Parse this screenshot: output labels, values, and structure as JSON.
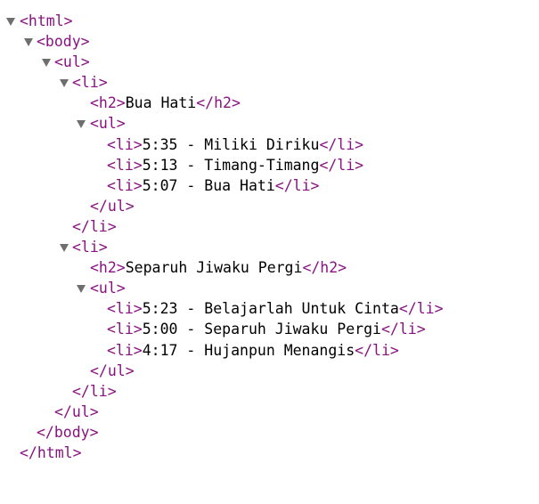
{
  "tags": {
    "html_open": "<html>",
    "html_close": "</html>",
    "body_open": "<body>",
    "body_close": "</body>",
    "ul_open": "<ul>",
    "ul_close": "</ul>",
    "li_open": "<li>",
    "li_close": "</li>",
    "h2_open": "<h2>",
    "h2_close": "</h2>"
  },
  "albums": [
    {
      "title": "Bua Hati",
      "tracks": [
        "5:35 - Miliki Diriku",
        "5:13 - Timang-Timang",
        "5:07 - Bua Hati"
      ]
    },
    {
      "title": "Separuh Jiwaku Pergi",
      "tracks": [
        "5:23 - Belajarlah Untuk Cinta",
        "5:00 - Separuh Jiwaku Pergi",
        "4:17 - Hujanpun Menangis"
      ]
    }
  ]
}
